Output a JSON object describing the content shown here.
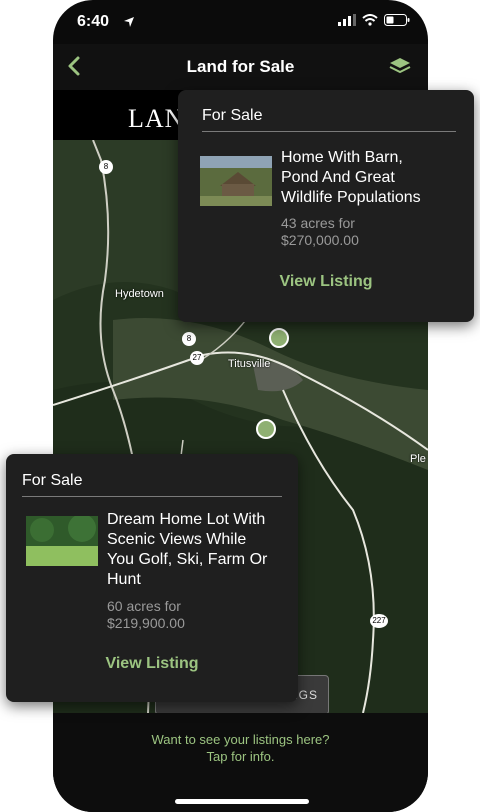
{
  "status": {
    "time": "6:40"
  },
  "nav": {
    "title": "Land for Sale",
    "back_icon": "chevron-left-icon",
    "layers_icon": "layers-icon"
  },
  "banner": {
    "text": "LAN"
  },
  "map": {
    "labels": {
      "hydetown": "Hydetown",
      "titusville": "Titusville",
      "pleasantville": "Ple"
    },
    "road_shields": [
      "8",
      "8",
      "27",
      "227"
    ]
  },
  "listings": [
    {
      "heading": "For Sale",
      "title_lines": [
        "Home With Barn,",
        "Pond And Great",
        "Wildlife Populations"
      ],
      "price_lines": [
        "43 acres for",
        "$270,000.00"
      ],
      "link": "View Listing"
    },
    {
      "heading": "For Sale",
      "title_lines": [
        "Dream Home Lot With",
        "Scenic Views While",
        "You Golf, Ski, Farm Or",
        "Hunt"
      ],
      "price_lines": [
        "60 acres for",
        "$219,900.00"
      ],
      "link": "View Listing"
    }
  ],
  "overlay_button": {
    "partial_text": "NGS"
  },
  "bottom": {
    "line1": "Want to see your listings here?",
    "line2": "Tap for info."
  },
  "colors": {
    "accent": "#9cc481",
    "card": "#1f1f1f",
    "map": "#24331f"
  }
}
